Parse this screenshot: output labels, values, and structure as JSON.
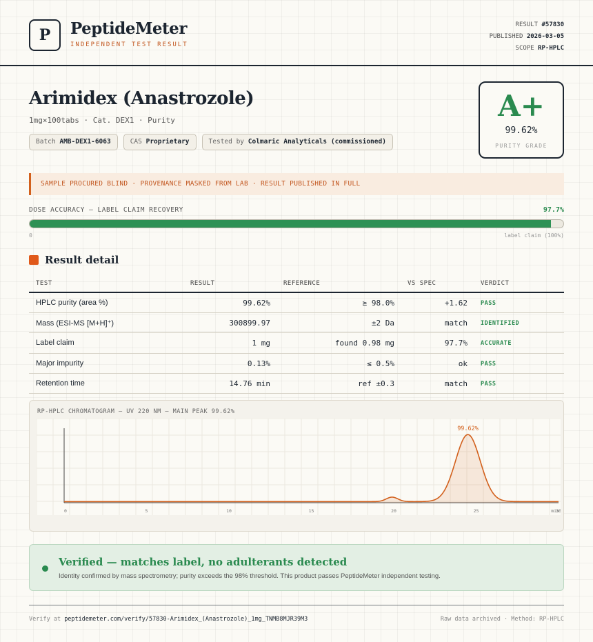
{
  "brand": {
    "logo_letter": "P",
    "name": "PeptideMeter",
    "tagline": "INDEPENDENT TEST RESULT"
  },
  "meta": {
    "result_label": "RESULT",
    "result_value": "#57830",
    "published_label": "PUBLISHED",
    "published_value": "2026-03-05",
    "scope_label": "SCOPE",
    "scope_value": "RP-HPLC"
  },
  "product": {
    "title": "Arimidex (Anastrozole)",
    "subtitle": "1mg×100tabs · Cat. DEX1 · Purity",
    "chips": [
      {
        "label": "Batch",
        "value": "AMB-DEX1-6063"
      },
      {
        "label": "CAS",
        "value": "Proprietary"
      },
      {
        "label": "Tested by",
        "value": "Colmaric Analyticals (commissioned)"
      }
    ]
  },
  "grade": {
    "letter": "A+",
    "purity": "99.62%",
    "label": "PURITY GRADE",
    "color": "#2a8a4f"
  },
  "notice": "SAMPLE PROCURED BLIND · PROVENANCE MASKED FROM LAB · RESULT PUBLISHED IN FULL",
  "dose": {
    "label": "DOSE ACCURACY — LABEL CLAIM RECOVERY",
    "value": "97.7%",
    "fraction": 0.977,
    "min_label": "0",
    "max_label": "label claim (100%)"
  },
  "results": {
    "section_title": "Result detail",
    "headers": {
      "test": "TEST",
      "result": "RESULT",
      "reference": "REFERENCE",
      "vs": "VS SPEC",
      "verdict": "VERDICT"
    },
    "rows": [
      {
        "test": "HPLC purity (area %)",
        "result": "99.62%",
        "reference": "≥ 98.0%",
        "vs": "+1.62",
        "verdict": "PASS"
      },
      {
        "test": "Mass (ESI-MS [M+H]⁺)",
        "result": "300899.97",
        "reference": "±2 Da",
        "vs": "match",
        "verdict": "IDENTIFIED"
      },
      {
        "test": "Label claim",
        "result": "1 mg",
        "reference": "found 0.98 mg",
        "vs": "97.7%",
        "verdict": "ACCURATE"
      },
      {
        "test": "Major impurity",
        "result": "0.13%",
        "reference": "≤ 0.5%",
        "vs": "ok",
        "verdict": "PASS"
      },
      {
        "test": "Retention time",
        "result": "14.76 min",
        "reference": "ref ±0.3",
        "vs": "match",
        "verdict": "PASS"
      }
    ]
  },
  "chromatogram": {
    "title": "RP-HPLC CHROMATOGRAM — UV 220 NM — MAIN PEAK 99.62%",
    "peak_label": "99.62%",
    "x_ticks": [
      "0",
      "5",
      "10",
      "15",
      "20",
      "25",
      "30"
    ],
    "x_unit": "min",
    "line_color": "#d2601c"
  },
  "chart_data": {
    "type": "line",
    "title": "RP-HPLC CHROMATOGRAM — UV 220 NM — MAIN PEAK 99.62%",
    "xlabel": "min",
    "ylabel": "",
    "xlim": [
      0,
      30
    ],
    "ylim": [
      0,
      100
    ],
    "x_ticks": [
      0,
      5,
      10,
      15,
      20,
      25,
      30
    ],
    "baseline": 1.5,
    "peaks": [
      {
        "x": 19.9,
        "height": 6,
        "width": 0.35
      },
      {
        "x": 24.5,
        "height": 90,
        "width": 0.75,
        "label": "99.62%"
      }
    ],
    "grid": true
  },
  "verified": {
    "title": "Verified — matches label, no adulterants detected",
    "subtitle": "Identity confirmed by mass spectrometry; purity exceeds the 98% threshold. This product passes PeptideMeter independent testing."
  },
  "footer": {
    "verify_prefix": "Verify at",
    "verify_url": "peptidemeter.com/verify/57830-Arimidex_(Anastrozole)_1mg_TNMB8MJR39M3",
    "right": "Raw data archived · Method: RP-HPLC"
  }
}
